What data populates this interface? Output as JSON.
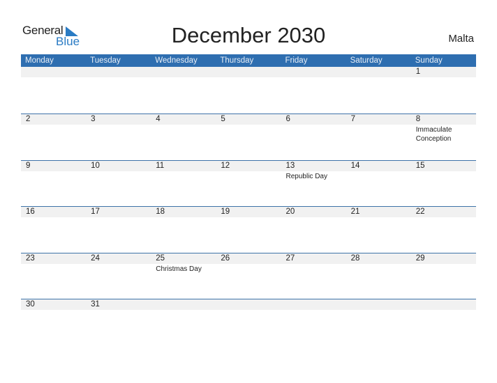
{
  "header": {
    "logo_general": "General",
    "logo_blue": "Blue",
    "title": "December 2030",
    "country": "Malta"
  },
  "colors": {
    "accent": "#2e6eb0",
    "logo_blue": "#2a7bc4",
    "band": "#f1f1f1"
  },
  "weekdays": [
    "Monday",
    "Tuesday",
    "Wednesday",
    "Thursday",
    "Friday",
    "Saturday",
    "Sunday"
  ],
  "weeks": [
    [
      {
        "d": ""
      },
      {
        "d": ""
      },
      {
        "d": ""
      },
      {
        "d": ""
      },
      {
        "d": ""
      },
      {
        "d": ""
      },
      {
        "d": "1"
      }
    ],
    [
      {
        "d": "2"
      },
      {
        "d": "3"
      },
      {
        "d": "4"
      },
      {
        "d": "5"
      },
      {
        "d": "6"
      },
      {
        "d": "7"
      },
      {
        "d": "8",
        "h": "Immaculate Conception"
      }
    ],
    [
      {
        "d": "9"
      },
      {
        "d": "10"
      },
      {
        "d": "11"
      },
      {
        "d": "12"
      },
      {
        "d": "13",
        "h": "Republic Day"
      },
      {
        "d": "14"
      },
      {
        "d": "15"
      }
    ],
    [
      {
        "d": "16"
      },
      {
        "d": "17"
      },
      {
        "d": "18"
      },
      {
        "d": "19"
      },
      {
        "d": "20"
      },
      {
        "d": "21"
      },
      {
        "d": "22"
      }
    ],
    [
      {
        "d": "23"
      },
      {
        "d": "24"
      },
      {
        "d": "25",
        "h": "Christmas Day"
      },
      {
        "d": "26"
      },
      {
        "d": "27"
      },
      {
        "d": "28"
      },
      {
        "d": "29"
      }
    ],
    [
      {
        "d": "30"
      },
      {
        "d": "31"
      },
      {
        "d": ""
      },
      {
        "d": ""
      },
      {
        "d": ""
      },
      {
        "d": ""
      },
      {
        "d": ""
      }
    ]
  ]
}
